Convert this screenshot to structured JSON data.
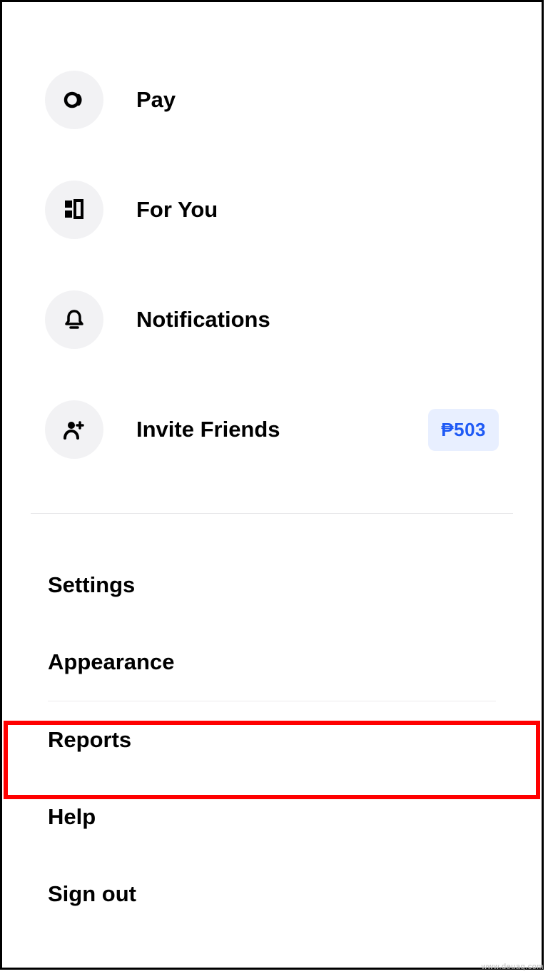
{
  "menu": {
    "items": [
      {
        "label": "Pay",
        "icon": "pay-icon"
      },
      {
        "label": "For You",
        "icon": "for-you-icon"
      },
      {
        "label": "Notifications",
        "icon": "bell-icon"
      },
      {
        "label": "Invite Friends",
        "icon": "invite-icon",
        "badge": "₱503"
      }
    ]
  },
  "textMenu": {
    "items": [
      {
        "label": "Settings"
      },
      {
        "label": "Appearance"
      },
      {
        "label": "Reports",
        "highlighted": true
      },
      {
        "label": "Help"
      },
      {
        "label": "Sign out"
      }
    ]
  },
  "watermark": "www.deuaq.com"
}
